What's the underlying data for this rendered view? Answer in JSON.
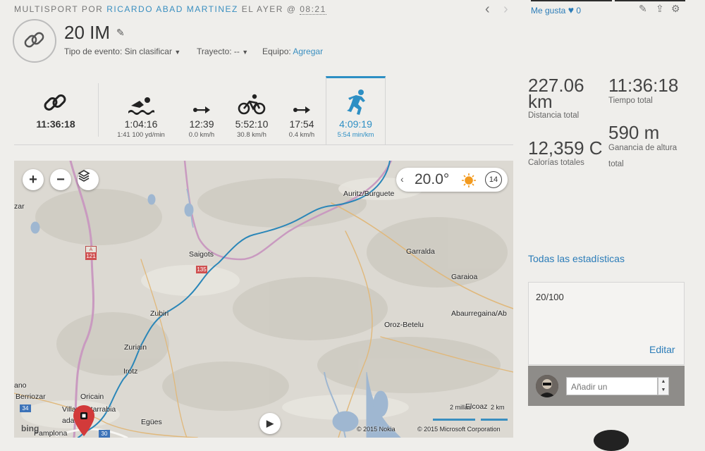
{
  "header": {
    "prefix": "MULTISPORT POR",
    "author": "RICARDO ABAD MARTINEZ",
    "when": "EL AYER @",
    "time": "08:21",
    "title": "20 IM",
    "event_label": "Tipo de evento:",
    "event_value": "Sin clasificar",
    "route_label": "Trayecto:",
    "route_value": "--",
    "gear_label": "Equipo:",
    "gear_link": "Agregar"
  },
  "social": {
    "like_label": "Me gusta",
    "like_count": "0"
  },
  "legs": [
    {
      "icon": "multisport-icon",
      "main": "11:36:18",
      "sub": ""
    },
    {
      "icon": "swim-icon",
      "main": "1:04:16",
      "sub": "1:41 100 yd/min"
    },
    {
      "icon": "transition-icon",
      "main": "12:39",
      "sub": "0.0 km/h"
    },
    {
      "icon": "bike-icon",
      "main": "5:52:10",
      "sub": "30.8 km/h"
    },
    {
      "icon": "transition-icon",
      "main": "17:54",
      "sub": "0.4 km/h"
    },
    {
      "icon": "run-icon",
      "main": "4:09:19",
      "sub": "5:54 min/km"
    }
  ],
  "stats": {
    "distance_value": "227.06",
    "distance_unit": "km",
    "distance_label": "Distancia total",
    "time_value": "11:36:18",
    "time_label": "Tiempo total",
    "calories_value": "12,359 C",
    "calories_label": "Calorías totales",
    "elevation_value": "590 m",
    "elevation_label_1": "Ganancia de altura",
    "elevation_label_2": "total",
    "all_stats_link": "Todas las estadísticas"
  },
  "notes": {
    "text": "20/100",
    "edit_label": "Editar"
  },
  "comment": {
    "placeholder": "Añadir un"
  },
  "map": {
    "temperature": "20.0°",
    "wind": "14",
    "scale_mi": "2 millas",
    "scale_km": "2 km",
    "provider": "bing",
    "copyright_nokia": "© 2015 Nokia",
    "copyright_ms": "© 2015 Microsoft Corporation",
    "road_121": "121",
    "road_135": "135",
    "road_34": "34",
    "road_30": "30",
    "road_a": "A",
    "towns": [
      "Auritz/Burguete",
      "Saigots",
      "Garralda",
      "Garaioa",
      "Zubiri",
      "Abaurregaina/Ab",
      "Oroz-Betelu",
      "Zuriain",
      "Irotz",
      "Oricain",
      "ano",
      "Berriozar",
      "Villava/Atarrabia",
      "Egües",
      "Elcoaz",
      "Pamplona",
      "zar",
      "ada"
    ]
  },
  "colors": {
    "accent": "#2d8fc4",
    "route": "#2a86b8",
    "road": "#c99ac0"
  }
}
